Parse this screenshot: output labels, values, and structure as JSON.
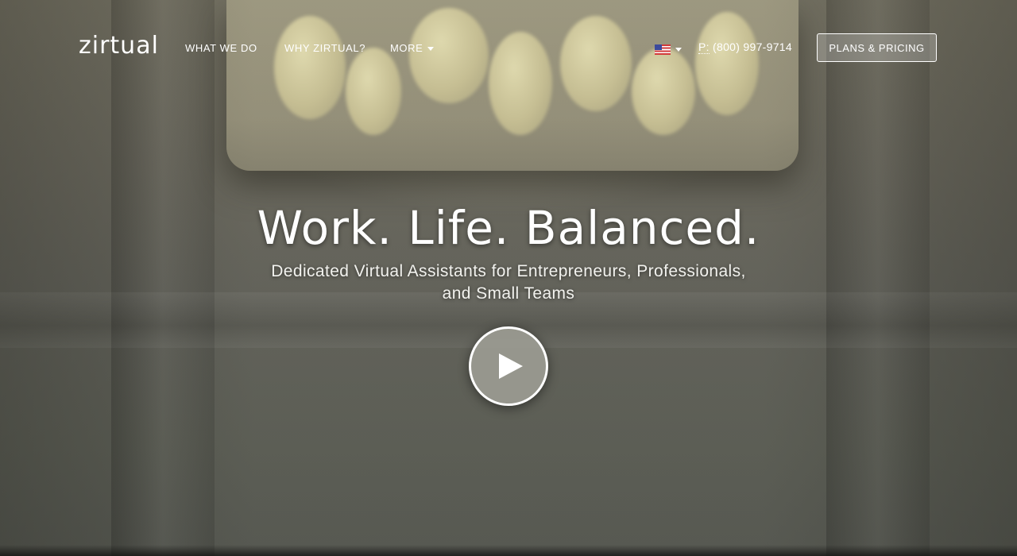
{
  "brand": {
    "logo_text": "zirtual"
  },
  "nav": {
    "items": [
      {
        "label": "WHAT WE DO"
      },
      {
        "label": "WHY ZIRTUAL?"
      },
      {
        "label": "MORE"
      }
    ],
    "locale_icon": "us-flag-icon",
    "phone": {
      "prefix": "P:",
      "number": "(800) 997-9714"
    },
    "cta_label": "PLANS & PRICING"
  },
  "hero": {
    "headline": "Work. Life. Balanced.",
    "subhead": "Dedicated Virtual Assistants for Entrepreneurs, Professionals, and Small Teams",
    "play_icon": "play-icon"
  },
  "colors": {
    "text": "#ffffff",
    "overlay": "#62625a"
  }
}
